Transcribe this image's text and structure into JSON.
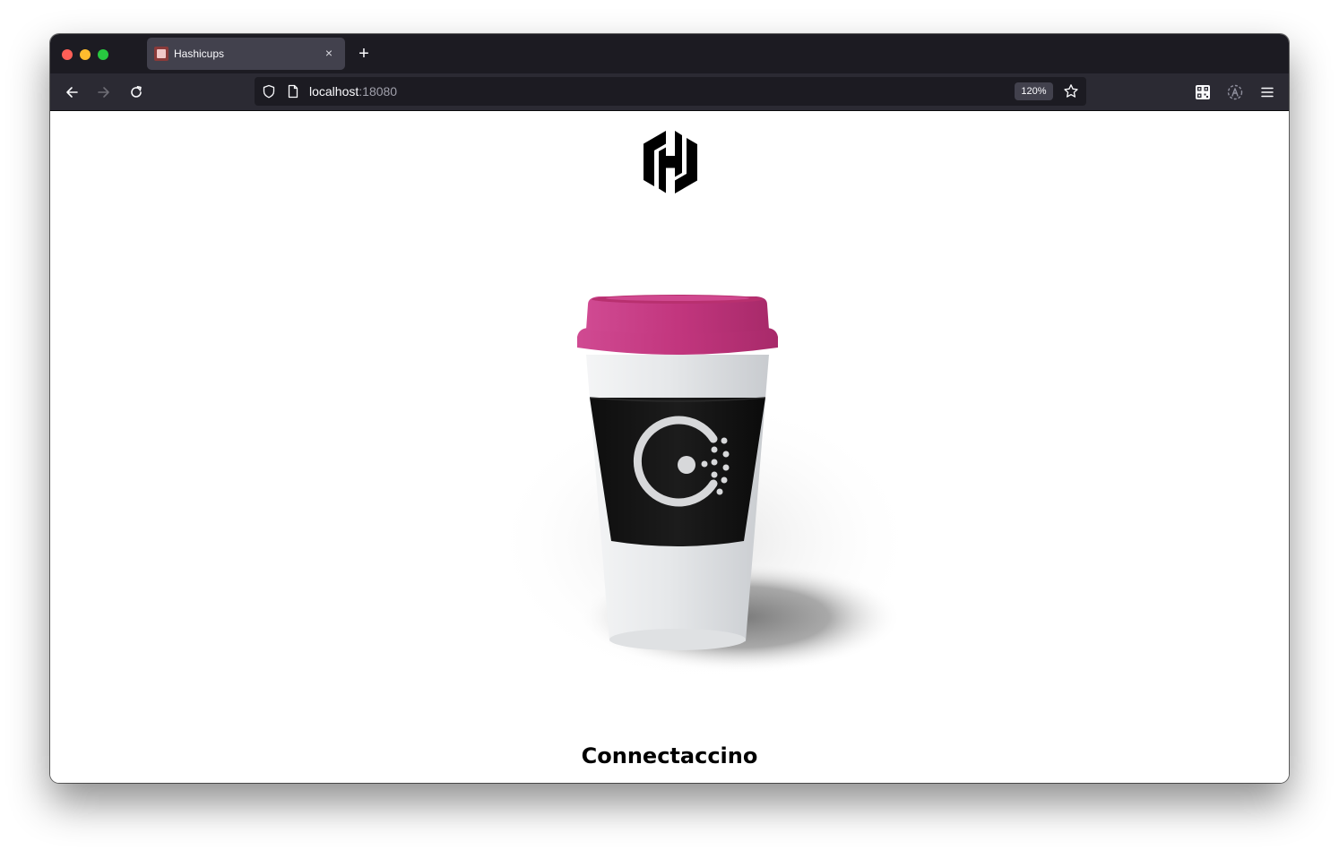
{
  "browser": {
    "tab": {
      "title": "Hashicups",
      "close_label": "×"
    },
    "new_tab_label": "+",
    "url": {
      "host": "localhost",
      "port": ":18080"
    },
    "zoom": "120%"
  },
  "page": {
    "logo_icon": "hashicorp-logo-icon",
    "product_image_icon": "coffee-cup-consul-image",
    "product_name": "Connectaccino"
  },
  "colors": {
    "cup_lid": "#c2367e",
    "cup_body": "#e9ecef",
    "cup_sleeve": "#141414",
    "chrome_dark": "#1c1b22",
    "chrome_toolbar": "#2b2a33"
  }
}
